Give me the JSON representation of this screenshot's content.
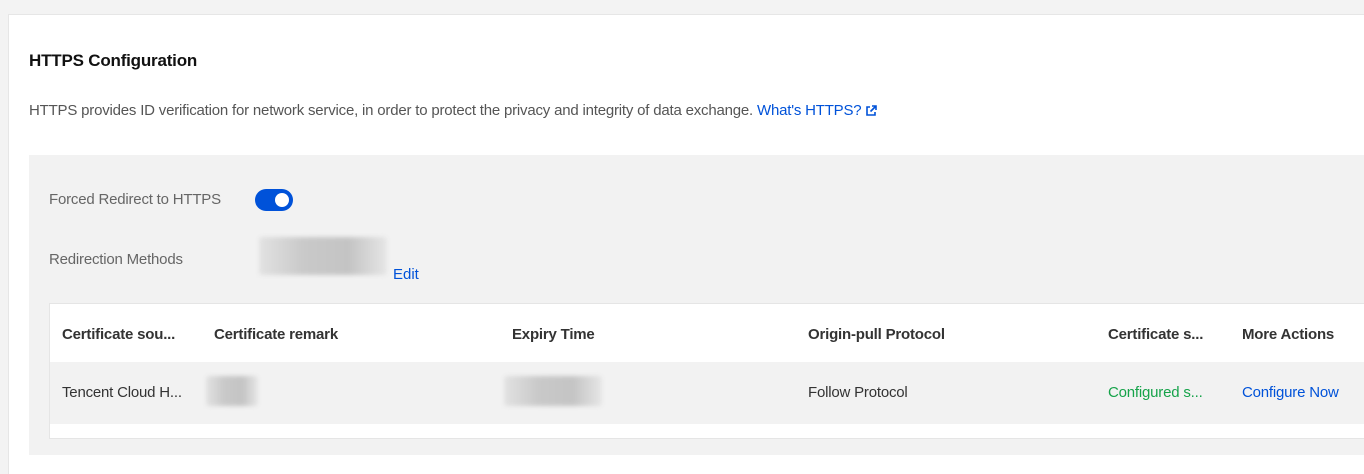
{
  "section": {
    "title": "HTTPS Configuration",
    "description": "HTTPS provides ID verification for network service, in order to protect the privacy and integrity of data exchange.",
    "help_link": "What's HTTPS?"
  },
  "settings": {
    "forced_redirect_label": "Forced Redirect to HTTPS",
    "forced_redirect_enabled": true,
    "redirection_methods_label": "Redirection Methods",
    "edit_label": "Edit"
  },
  "table": {
    "columns": [
      "Certificate sou...",
      "Certificate remark",
      "Expiry Time",
      "Origin-pull Protocol",
      "Certificate s...",
      "More Actions"
    ],
    "rows": [
      {
        "certificate_source": "Tencent Cloud H...",
        "origin_pull_protocol": "Follow Protocol",
        "certificate_status": "Configured s...",
        "action": "Configure Now"
      }
    ]
  },
  "colors": {
    "accent": "#0052d9",
    "success": "#16a34a"
  }
}
